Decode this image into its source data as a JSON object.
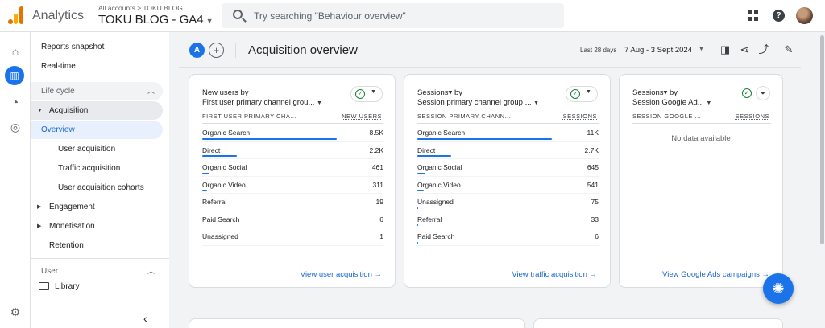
{
  "app": {
    "name": "Analytics",
    "breadcrumb": "All accounts > TOKU BLOG",
    "property": "TOKU BLOG - GA4"
  },
  "search": {
    "placeholder": "Try searching \"Behaviour overview\""
  },
  "nav": {
    "items": [
      {
        "label": "Reports snapshot"
      },
      {
        "label": "Real-time"
      },
      {
        "label": "Life cycle"
      },
      {
        "label": "Acquisition"
      },
      {
        "label": "Overview"
      },
      {
        "label": "User acquisition"
      },
      {
        "label": "Traffic acquisition"
      },
      {
        "label": "User acquisition cohorts"
      },
      {
        "label": "Engagement"
      },
      {
        "label": "Monetisation"
      },
      {
        "label": "Retention"
      },
      {
        "label": "User"
      },
      {
        "label": "Library"
      }
    ]
  },
  "header": {
    "compare_label": "A",
    "title": "Acquisition overview",
    "date_label": "Last 28 days",
    "date_range": "7 Aug - 3 Sept 2024"
  },
  "cards": [
    {
      "title1": "New users by",
      "title2": "First user primary channel grou...",
      "col1": "FIRST USER PRIMARY CHA...",
      "col2": "NEW USERS",
      "rows": [
        {
          "label": "Organic Search",
          "value": "8.5K",
          "share": 1.0
        },
        {
          "label": "Direct",
          "value": "2.2K",
          "share": 0.26
        },
        {
          "label": "Organic Social",
          "value": "461",
          "share": 0.055
        },
        {
          "label": "Organic Video",
          "value": "311",
          "share": 0.037
        },
        {
          "label": "Referral",
          "value": "19",
          "share": 0
        },
        {
          "label": "Paid Search",
          "value": "6",
          "share": 0
        },
        {
          "label": "Unassigned",
          "value": "1",
          "share": 0
        }
      ],
      "link": "View user acquisition →"
    },
    {
      "title1": "Sessions▾ by",
      "title2": "Session primary channel group ...",
      "col1": "SESSION PRIMARY CHANN...",
      "col2": "SESSIONS",
      "rows": [
        {
          "label": "Organic Search",
          "value": "11K",
          "share": 1.0
        },
        {
          "label": "Direct",
          "value": "2.7K",
          "share": 0.25
        },
        {
          "label": "Organic Social",
          "value": "645",
          "share": 0.06
        },
        {
          "label": "Organic Video",
          "value": "541",
          "share": 0.05
        },
        {
          "label": "Unassigned",
          "value": "75",
          "share": 0.007
        },
        {
          "label": "Referral",
          "value": "33",
          "share": 0.003
        },
        {
          "label": "Paid Search",
          "value": "6",
          "share": 0.001
        }
      ],
      "link": "View traffic acquisition →"
    },
    {
      "title1": "Sessions▾ by",
      "title2": "Session Google Ad...",
      "col1": "SESSION GOOGLE ...",
      "col2": "SESSIONS",
      "rows": [],
      "empty_text": "No data available",
      "link": "View Google Ads campaigns →"
    }
  ],
  "colors": {
    "accent": "#1a73e8",
    "bar": "#1a73e8",
    "check": "#188038"
  }
}
